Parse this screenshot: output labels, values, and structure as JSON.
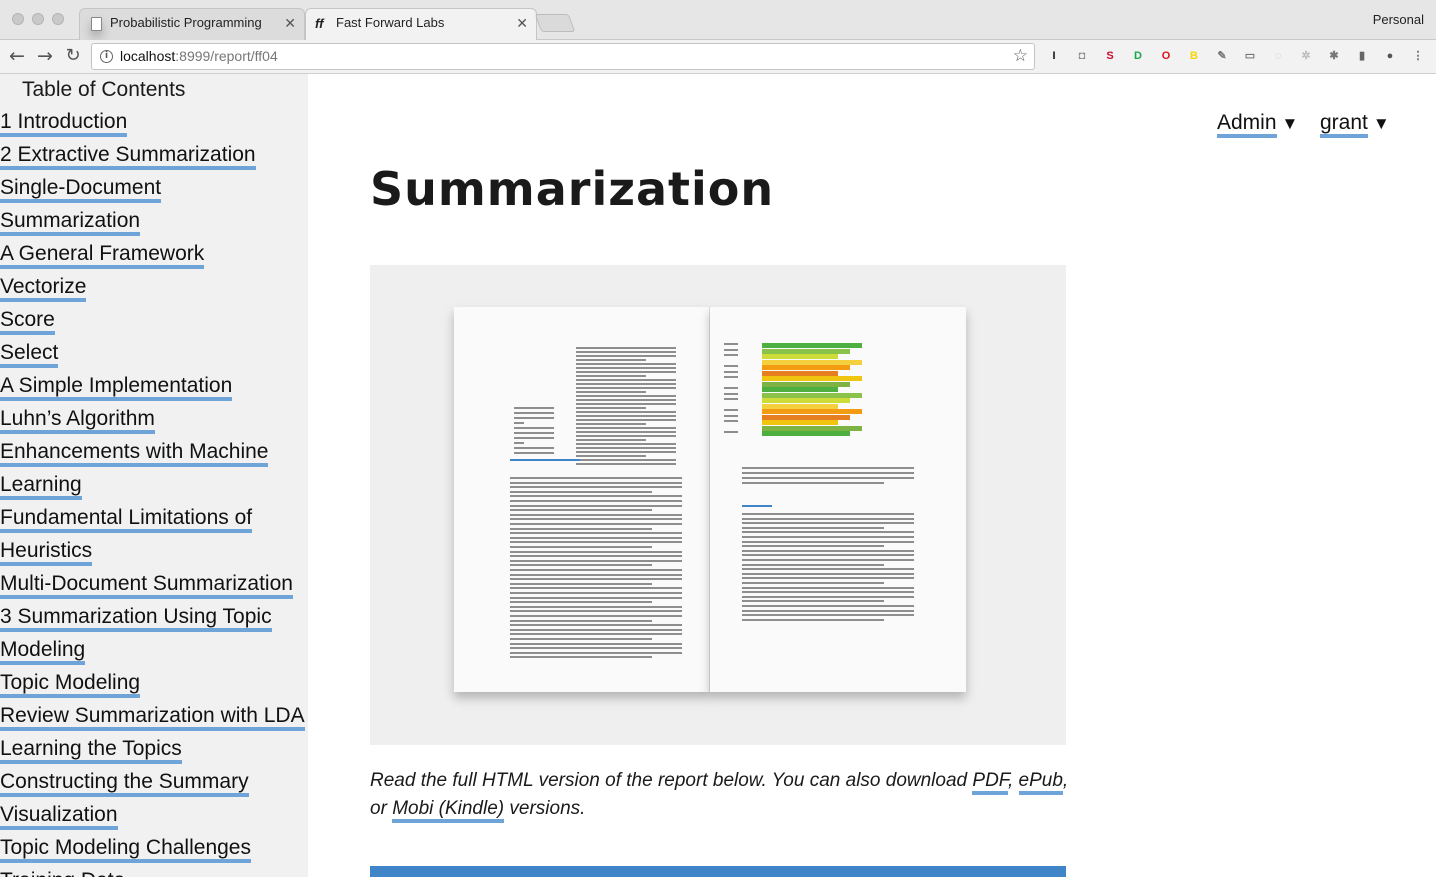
{
  "browser": {
    "tabs": [
      {
        "title": "Probabilistic Programming",
        "active": false
      },
      {
        "title": "Fast Forward Labs",
        "active": true
      }
    ],
    "profile_label": "Personal",
    "url_host": "localhost",
    "url_rest": ":8999/report/ff04",
    "extensions": [
      {
        "icon": "instapaper-icon",
        "glyph": "I",
        "color": "#111"
      },
      {
        "icon": "camera-icon",
        "glyph": "◘",
        "color": "#888"
      },
      {
        "icon": "stylish-icon",
        "glyph": "S",
        "color": "#c8102e"
      },
      {
        "icon": "grammarly-icon",
        "glyph": "D",
        "color": "#15a84a"
      },
      {
        "icon": "opera-icon",
        "glyph": "O",
        "color": "#e3101b"
      },
      {
        "icon": "bookmarklet-icon",
        "glyph": "B",
        "color": "#f5d800"
      },
      {
        "icon": "pin-icon",
        "glyph": "✎",
        "color": "#777"
      },
      {
        "icon": "cast-icon",
        "glyph": "▭",
        "color": "#777"
      },
      {
        "icon": "circle-ext-icon",
        "glyph": "◌",
        "color": "#bbb"
      },
      {
        "icon": "gear-ext-icon",
        "glyph": "✲",
        "color": "#bbb"
      },
      {
        "icon": "bug-icon",
        "glyph": "✱",
        "color": "#777"
      },
      {
        "icon": "reader-icon",
        "glyph": "▮",
        "color": "#666"
      },
      {
        "icon": "fox-icon",
        "glyph": "●",
        "color": "#555"
      },
      {
        "icon": "menu-dots-icon",
        "glyph": "⋮",
        "color": "#666"
      }
    ]
  },
  "sidebar": {
    "title": "Table of Contents",
    "items": [
      "1 Introduction",
      "2 Extractive Summarization",
      "Single-Document",
      "Summarization",
      "A General Framework",
      "Vectorize",
      "Score",
      "Select",
      "A Simple Implementation",
      "Luhn’s Algorithm",
      "Enhancements with Machine",
      "Learning",
      "Fundamental Limitations of",
      "Heuristics",
      "Multi-Document Summarization",
      "3 Summarization Using Topic",
      "Modeling",
      "Topic Modeling",
      "Review Summarization with LDA",
      "Learning the Topics",
      "Constructing the Summary",
      "Visualization",
      "Topic Modeling Challenges",
      "Training Data"
    ]
  },
  "main": {
    "admin_menu": "Admin",
    "user_menu": "grant",
    "caret": "▼",
    "title": "Summarization",
    "intro_prefix": "Read the full HTML version of the report below. You can also download ",
    "link_pdf": "PDF",
    "sep1": ", ",
    "link_epub": "ePub",
    "sep2": ", or ",
    "link_mobi": "Mobi (Kindle)",
    "intro_suffix": " versions."
  },
  "colors": {
    "link_underline": "#6ea4d8",
    "accent_blue": "#3f85c8",
    "sidebar_bg": "#f1f1f1"
  }
}
